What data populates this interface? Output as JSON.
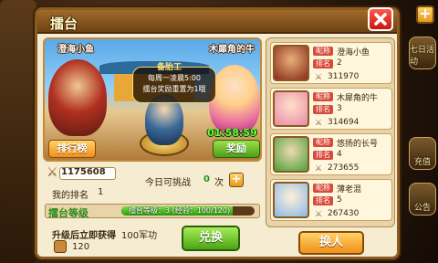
{
  "dialog": {
    "title": "擂台"
  },
  "arena": {
    "left_fighter": "澄海小鱼",
    "right_fighter": "木犀角的牛",
    "speech": {
      "header": "备胎工",
      "line1": "每周一凌晨5:00",
      "line2": "擂台奖励重置为1哦"
    },
    "timer": "01:58:59",
    "rank_button": "排行榜",
    "reward_button": "奖励"
  },
  "player": {
    "power": "1175608",
    "my_rank_label": "我的排名",
    "my_rank": "1",
    "challenge_label": "今日可挑战",
    "challenge_count": "0",
    "challenge_unit": "次"
  },
  "level": {
    "title": "擂台等级",
    "text": "擂台等级：3 (经验：100/120)",
    "progress": 0.833
  },
  "upgrade": {
    "text": "升级后立即获得",
    "reward": "100军功",
    "currency": "120",
    "exchange_button": "兑换"
  },
  "opponents": [
    {
      "name_label": "昵称",
      "name": "澄海小鱼",
      "rank_label": "排名",
      "rank": "2",
      "power": "311970"
    },
    {
      "name_label": "昵称",
      "name": "木犀角的牛",
      "rank_label": "排名",
      "rank": "3",
      "power": "314694"
    },
    {
      "name_label": "昵称",
      "name": "悠扬的长号",
      "rank_label": "排名",
      "rank": "4",
      "power": "273655"
    },
    {
      "name_label": "昵称",
      "name": "薄老混",
      "rank_label": "排名",
      "rank": "5",
      "power": "267430"
    }
  ],
  "swap_button": "换人",
  "side": {
    "events_label": "七日活动",
    "pay_label": "充值",
    "ann_label": "公告"
  },
  "colors": {
    "accent": "#f09018",
    "confirm": "#4aa416",
    "title_bar": "#8a5a20"
  }
}
